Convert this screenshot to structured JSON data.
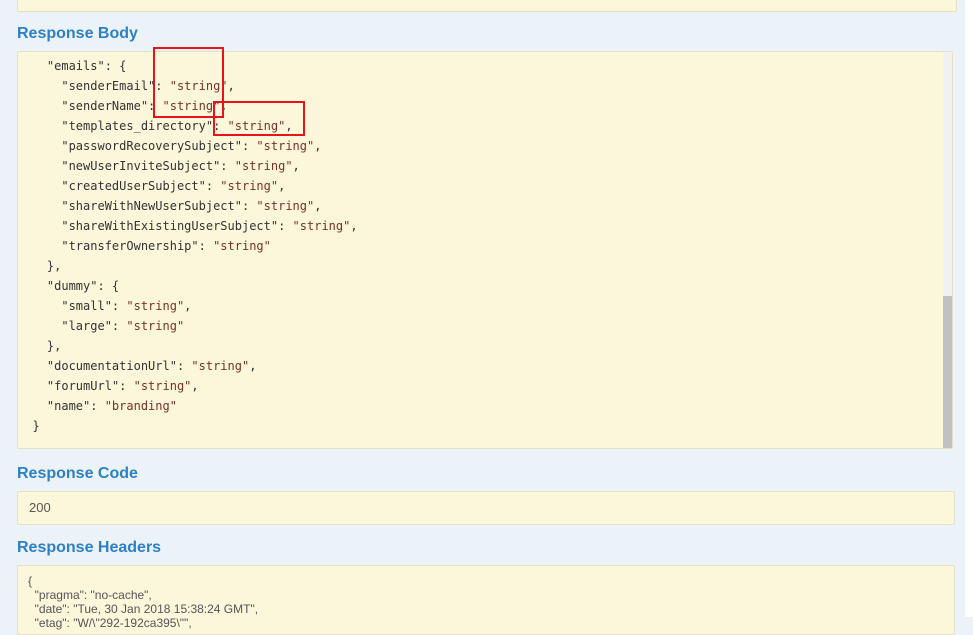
{
  "sections": {
    "response_body": "Response Body",
    "response_code": "Response Code",
    "response_headers": "Response Headers"
  },
  "response_body_lines": [
    [
      {
        "t": "k",
        "v": "    \"emails\": {"
      }
    ],
    [
      {
        "t": "k",
        "v": "      \"senderEmail\": "
      },
      {
        "t": "s",
        "v": "\"string\""
      },
      {
        "t": "k",
        "v": ","
      }
    ],
    [
      {
        "t": "k",
        "v": "      \"senderName\": "
      },
      {
        "t": "s",
        "v": "\"string\""
      },
      {
        "t": "k",
        "v": ","
      }
    ],
    [
      {
        "t": "k",
        "v": "      \"templates_directory\": "
      },
      {
        "t": "s",
        "v": "\"string\""
      },
      {
        "t": "k",
        "v": ","
      }
    ],
    [
      {
        "t": "k",
        "v": "      \"passwordRecoverySubject\": "
      },
      {
        "t": "s",
        "v": "\"string\""
      },
      {
        "t": "k",
        "v": ","
      }
    ],
    [
      {
        "t": "k",
        "v": "      \"newUserInviteSubject\": "
      },
      {
        "t": "s",
        "v": "\"string\""
      },
      {
        "t": "k",
        "v": ","
      }
    ],
    [
      {
        "t": "k",
        "v": "      \"createdUserSubject\": "
      },
      {
        "t": "s",
        "v": "\"string\""
      },
      {
        "t": "k",
        "v": ","
      }
    ],
    [
      {
        "t": "k",
        "v": "      \"shareWithNewUserSubject\": "
      },
      {
        "t": "s",
        "v": "\"string\""
      },
      {
        "t": "k",
        "v": ","
      }
    ],
    [
      {
        "t": "k",
        "v": "      \"shareWithExistingUserSubject\": "
      },
      {
        "t": "s",
        "v": "\"string\""
      },
      {
        "t": "k",
        "v": ","
      }
    ],
    [
      {
        "t": "k",
        "v": "      \"transferOwnership\": "
      },
      {
        "t": "s",
        "v": "\"string\""
      }
    ],
    [
      {
        "t": "k",
        "v": "    },"
      }
    ],
    [
      {
        "t": "k",
        "v": "    \"dummy\": {"
      }
    ],
    [
      {
        "t": "k",
        "v": "      \"small\": "
      },
      {
        "t": "s",
        "v": "\"string\""
      },
      {
        "t": "k",
        "v": ","
      }
    ],
    [
      {
        "t": "k",
        "v": "      \"large\": "
      },
      {
        "t": "s",
        "v": "\"string\""
      }
    ],
    [
      {
        "t": "k",
        "v": "    },"
      }
    ],
    [
      {
        "t": "k",
        "v": "    \"documentationUrl\": "
      },
      {
        "t": "s",
        "v": "\"string\""
      },
      {
        "t": "k",
        "v": ","
      }
    ],
    [
      {
        "t": "k",
        "v": "    \"forumUrl\": "
      },
      {
        "t": "s",
        "v": "\"string\""
      },
      {
        "t": "k",
        "v": ","
      }
    ],
    [
      {
        "t": "k",
        "v": "    \"name\": "
      },
      {
        "t": "s",
        "v": "\"branding\""
      }
    ],
    [
      {
        "t": "k",
        "v": "  }"
      }
    ]
  ],
  "response_code": "200",
  "response_headers_lines": [
    "{",
    "  \"pragma\": \"no-cache\",",
    "  \"date\": \"Tue, 30 Jan 2018 15:38:24 GMT\",",
    "  \"etag\": \"W/\\\"292-192ca395\\\"\","
  ],
  "colors": {
    "section_title": "#2d7fc7",
    "box_background": "#fcf6db",
    "json_string": "#7a2f2f",
    "highlight": "#e8141a"
  }
}
